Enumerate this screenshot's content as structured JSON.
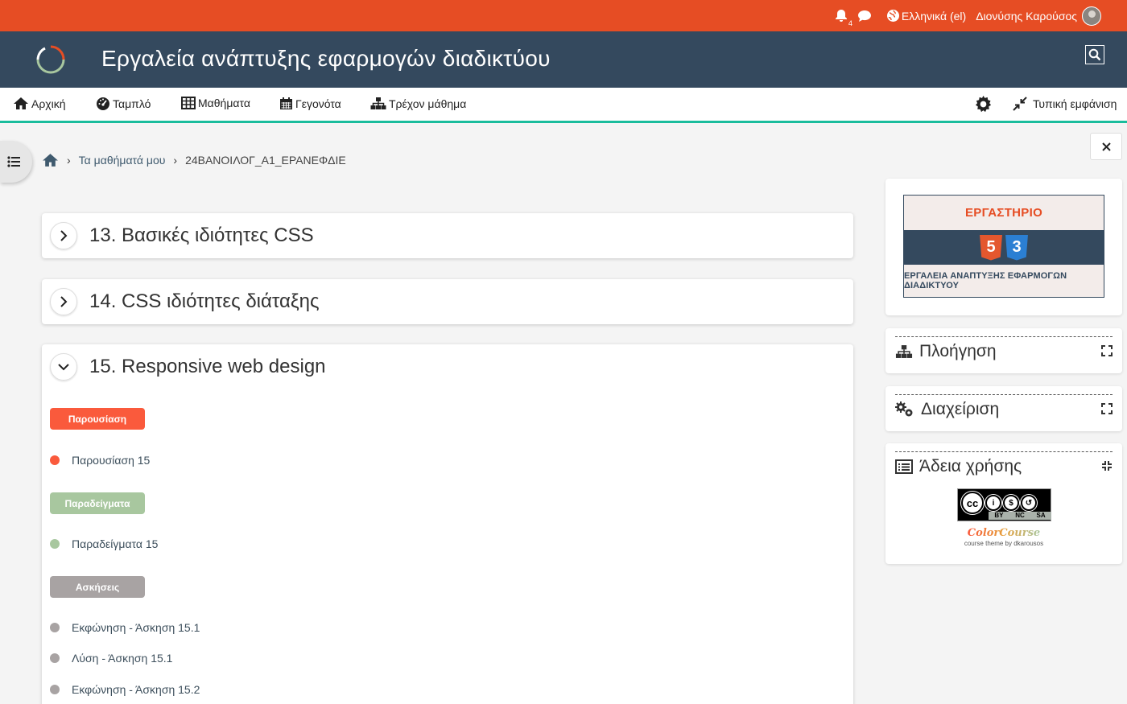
{
  "topbar": {
    "notification_count": "4",
    "language": "Ελληνικά (el)",
    "user_name": "Διονύσης Καρούσος"
  },
  "header": {
    "site_title": "Εργαλεία ανάπτυξης εφαρμογών διαδικτύου"
  },
  "nav": {
    "items": [
      {
        "label": "Αρχική",
        "icon": "home-icon"
      },
      {
        "label": "Ταμπλό",
        "icon": "dashboard-icon"
      },
      {
        "label": "Μαθήματα",
        "icon": "table-icon"
      },
      {
        "label": "Γεγονότα",
        "icon": "calendar-icon"
      },
      {
        "label": "Τρέχον μάθημα",
        "icon": "sitemap-icon"
      }
    ],
    "standard_view_label": "Τυπική εμφάνιση"
  },
  "breadcrumb": {
    "my_courses": "Τα μαθήματά μου",
    "course": "24ΒΑΝΟΙΛΟΓ_Α1_ΕΡΑΝΕΦΔΙΕ"
  },
  "sections": [
    {
      "title": "13. Βασικές ιδιότητες CSS",
      "expanded": false
    },
    {
      "title": "14. CSS ιδιότητες διάταξης",
      "expanded": false
    },
    {
      "title": "15. Responsive web design",
      "expanded": true
    }
  ],
  "section15": {
    "groups": [
      {
        "label": "Παρουσίαση",
        "color": "#fa5a3c",
        "activities": [
          "Παρουσίαση 15"
        ]
      },
      {
        "label": "Παραδείγματα",
        "color": "#a8c79f",
        "activities": [
          "Παραδείγματα 15"
        ]
      },
      {
        "label": "Ασκήσεις",
        "color": "#a8a3a3",
        "activities": [
          "Εκφώνηση - Άσκηση 15.1",
          "Λύση - Άσκηση 15.1",
          "Εκφώνηση - Άσκηση 15.2"
        ]
      }
    ]
  },
  "drawer": {
    "banner_top": "ΕΡΓΑΣΤΗΡΙΟ",
    "banner_html": "5",
    "banner_css": "3",
    "banner_bottom": "ΕΡΓΑΛΕΙΑ ΑΝΑΠΤΥΞΗΣ ΕΦΑΡΜΟΓΩΝ ΔΙΑΔΙΚΤΥΟΥ",
    "navigation_title": "Πλοήγηση",
    "admin_title": "Διαχείριση",
    "license_title": "Άδεια χρήσης",
    "cc_labels": [
      "BY",
      "NC",
      "SA"
    ],
    "cc_logo": "cc",
    "colorcourse": "ColorCourse",
    "colorcourse_byline": "course theme by dkarousos"
  },
  "colors": {
    "topbar": "#e64d24",
    "header": "#34495e",
    "nav_underline": "#1abc9c"
  }
}
